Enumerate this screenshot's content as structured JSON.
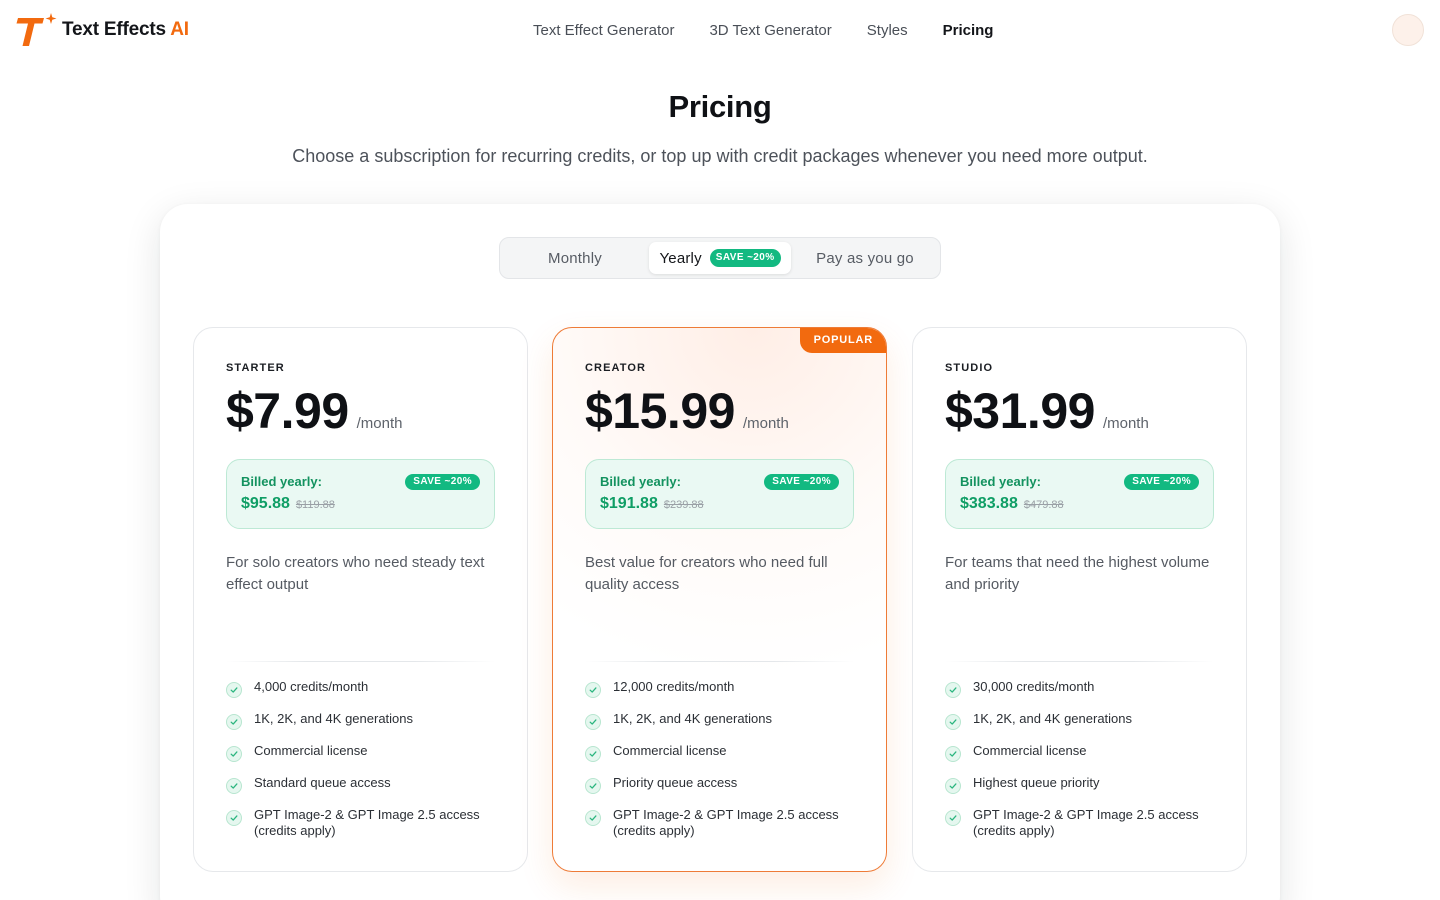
{
  "brand": {
    "name_main": "Text Effects",
    "name_accent": "AI",
    "accent_color": "#f26a0f"
  },
  "nav": {
    "items": [
      {
        "label": "Text Effect Generator"
      },
      {
        "label": "3D Text Generator"
      },
      {
        "label": "Styles"
      },
      {
        "label": "Pricing",
        "active": true
      }
    ]
  },
  "header": {
    "title": "Pricing",
    "subtitle": "Choose a subscription for recurring credits, or top up with credit packages whenever you need more output."
  },
  "billing_toggle": {
    "options": [
      {
        "label": "Monthly"
      },
      {
        "label": "Yearly",
        "badge": "SAVE ~20%",
        "selected": true
      },
      {
        "label": "Pay as you go"
      }
    ]
  },
  "plans": [
    {
      "tier": "STARTER",
      "price": "$7.99",
      "period": "/month",
      "billed_label": "Billed yearly:",
      "save_badge": "SAVE ~20%",
      "billed_amount": "$95.88",
      "billed_was": "$119.88",
      "description": "For solo creators who need steady text effect output",
      "features": [
        "4,000 credits/month",
        "1K, 2K, and 4K generations",
        "Commercial license",
        "Standard queue access",
        "GPT Image-2 & GPT Image 2.5 access (credits apply)"
      ]
    },
    {
      "tier": "CREATOR",
      "badge": "POPULAR",
      "price": "$15.99",
      "period": "/month",
      "billed_label": "Billed yearly:",
      "save_badge": "SAVE ~20%",
      "billed_amount": "$191.88",
      "billed_was": "$239.88",
      "description": "Best value for creators who need full quality access",
      "features": [
        "12,000 credits/month",
        "1K, 2K, and 4K generations",
        "Commercial license",
        "Priority queue access",
        "GPT Image-2 & GPT Image 2.5 access (credits apply)"
      ]
    },
    {
      "tier": "STUDIO",
      "price": "$31.99",
      "period": "/month",
      "billed_label": "Billed yearly:",
      "save_badge": "SAVE ~20%",
      "billed_amount": "$383.88",
      "billed_was": "$479.88",
      "description": "For teams that need the highest volume and priority",
      "features": [
        "30,000 credits/month",
        "1K, 2K, and 4K generations",
        "Commercial license",
        "Highest queue priority",
        "GPT Image-2 & GPT Image 2.5 access (credits apply)"
      ]
    }
  ]
}
